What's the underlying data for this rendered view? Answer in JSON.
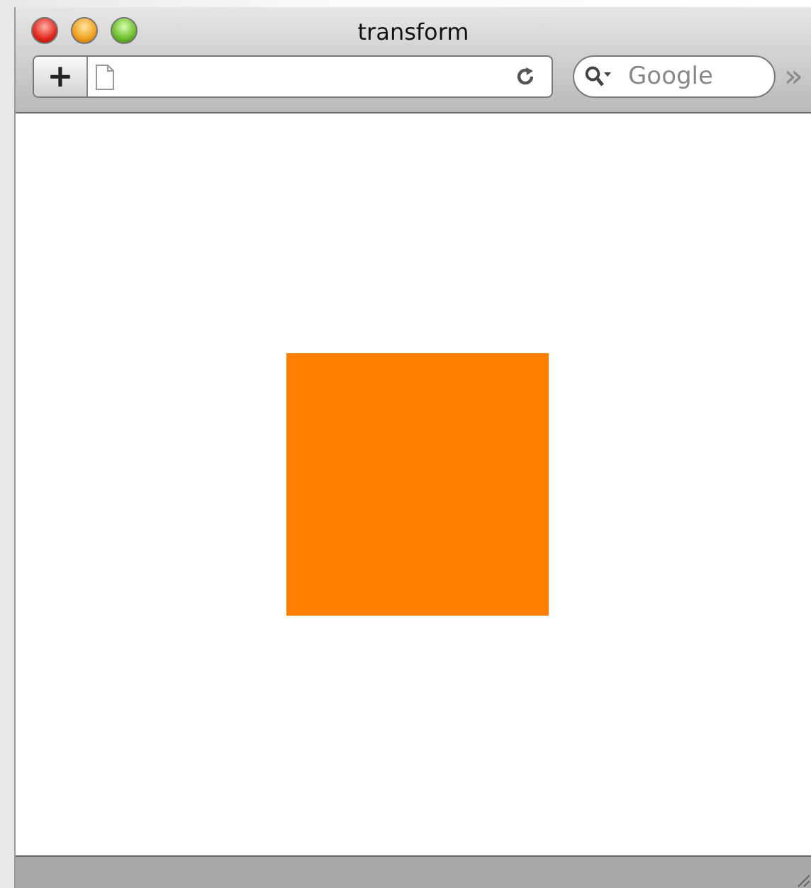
{
  "window": {
    "title": "transform"
  },
  "toolbar": {
    "add_button": "+",
    "search": {
      "placeholder": "Google"
    },
    "overflow": "»"
  }
}
